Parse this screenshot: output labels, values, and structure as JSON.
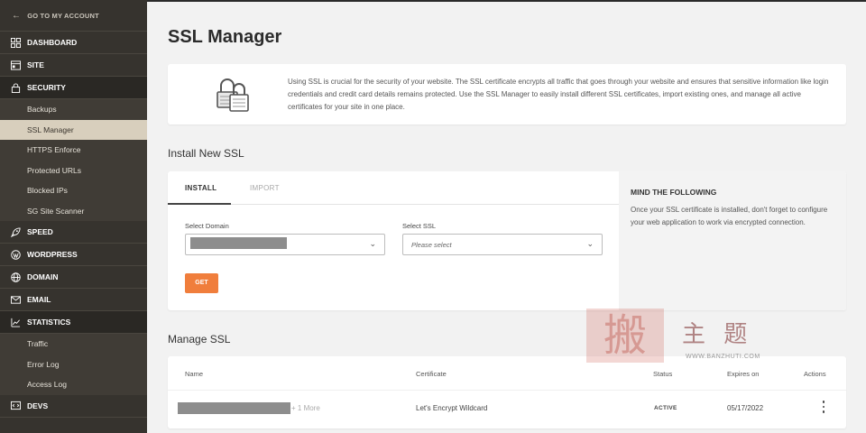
{
  "sidebar": {
    "back_label": "GO TO MY ACCOUNT",
    "sections": [
      {
        "label": "DASHBOARD",
        "icon": "dashboard-icon"
      },
      {
        "label": "SITE",
        "icon": "site-icon"
      },
      {
        "label": "SECURITY",
        "icon": "lock-icon",
        "open": true
      },
      {
        "label": "SPEED",
        "icon": "rocket-icon"
      },
      {
        "label": "WORDPRESS",
        "icon": "wordpress-icon"
      },
      {
        "label": "DOMAIN",
        "icon": "globe-icon"
      },
      {
        "label": "EMAIL",
        "icon": "envelope-icon"
      },
      {
        "label": "STATISTICS",
        "icon": "chart-icon",
        "open": true
      },
      {
        "label": "DEVS",
        "icon": "code-icon"
      }
    ],
    "security_items": [
      "Backups",
      "SSL Manager",
      "HTTPS Enforce",
      "Protected URLs",
      "Blocked IPs",
      "SG Site Scanner"
    ],
    "security_active": "SSL Manager",
    "statistics_items": [
      "Traffic",
      "Error Log",
      "Access Log"
    ]
  },
  "page": {
    "title": "SSL Manager",
    "intro": "Using SSL is crucial for the security of your website. The SSL certificate encrypts all traffic that goes through your website and ensures that sensitive information like login credentials and credit card details remains protected. Use the SSL Manager to easily install different SSL certificates, import existing ones, and manage all active certificates for your site in one place."
  },
  "install": {
    "section_title": "Install New SSL",
    "tabs": [
      "INSTALL",
      "IMPORT"
    ],
    "domain_label": "Select Domain",
    "ssl_label": "Select SSL",
    "ssl_placeholder": "Please select",
    "get_label": "GET",
    "mind_title": "MIND THE FOLLOWING",
    "mind_text": "Once your SSL certificate is installed, don't forget to configure your web application to work via encrypted connection."
  },
  "manage": {
    "section_title": "Manage SSL",
    "headers": {
      "name": "Name",
      "certificate": "Certificate",
      "status": "Status",
      "expires": "Expires on",
      "actions": "Actions"
    },
    "rows": [
      {
        "more": "+ 1 More",
        "certificate": "Let's Encrypt Wildcard",
        "status": "ACTIVE",
        "expires": "05/17/2022"
      }
    ]
  },
  "watermark": {
    "text": "主 题",
    "url": "WWW.BANZHUTI.COM"
  },
  "colors": {
    "accent": "#f07e3c",
    "sidebar": "#36332e",
    "active_item": "#d8cfbd"
  }
}
